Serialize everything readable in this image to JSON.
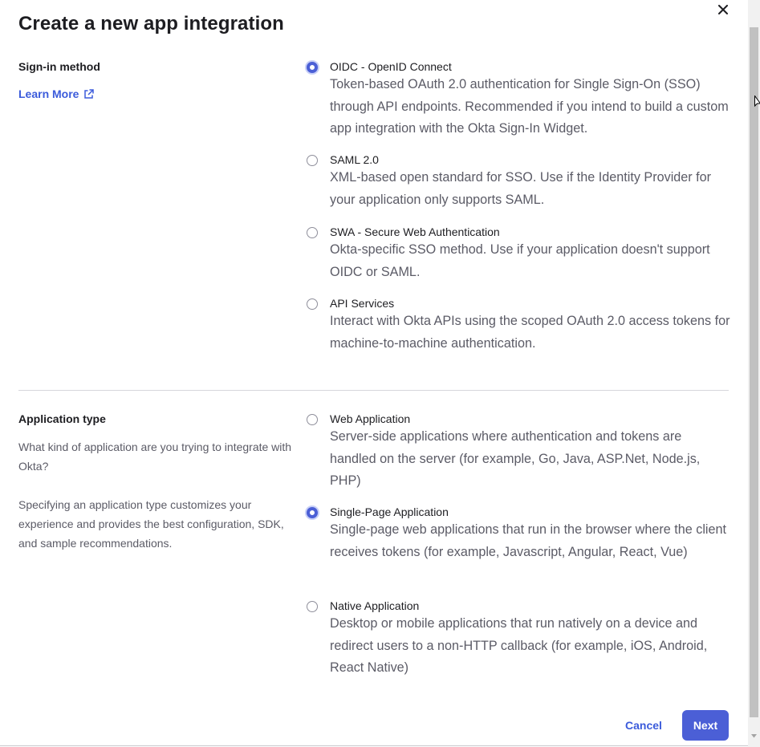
{
  "dialog": {
    "title": "Create a new app integration",
    "close_icon": "close-icon"
  },
  "sign_in": {
    "label": "Sign-in method",
    "learn_more": "Learn More",
    "learn_more_icon": "external-link-icon",
    "options": [
      {
        "title": "OIDC - OpenID Connect",
        "description": "Token-based OAuth 2.0 authentication for Single Sign-On (SSO) through API endpoints. Recommended if you intend to build a custom app integration with the Okta Sign-In Widget.",
        "selected": true
      },
      {
        "title": "SAML 2.0",
        "description": "XML-based open standard for SSO. Use if the Identity Provider for your application only supports SAML.",
        "selected": false
      },
      {
        "title": "SWA - Secure Web Authentication",
        "description": "Okta-specific SSO method. Use if your application doesn't support OIDC or SAML.",
        "selected": false
      },
      {
        "title": "API Services",
        "description": "Interact with Okta APIs using the scoped OAuth 2.0 access tokens for machine-to-machine authentication.",
        "selected": false
      }
    ]
  },
  "app_type": {
    "label": "Application type",
    "help_1": "What kind of application are you trying to integrate with Okta?",
    "help_2": "Specifying an application type customizes your experience and provides the best configuration, SDK, and sample recommendations.",
    "options": [
      {
        "title": "Web Application",
        "description": "Server-side applications where authentication and tokens are handled on the server (for example, Go, Java, ASP.Net, Node.js, PHP)",
        "selected": false
      },
      {
        "title": "Single-Page Application",
        "description": "Single-page web applications that run in the browser where the client receives tokens (for example, Javascript, Angular, React, Vue)",
        "selected": true
      },
      {
        "title": "Native Application",
        "description": "Desktop or mobile applications that run natively on a device and redirect users to a non-HTTP callback (for example, iOS, Android, React Native)",
        "selected": false
      }
    ]
  },
  "footer": {
    "cancel_label": "Cancel",
    "next_label": "Next"
  },
  "colors": {
    "accent": "#4b5fd6",
    "link": "#3b5bdb",
    "text": "#1d1d21",
    "muted": "#5b5b66"
  }
}
